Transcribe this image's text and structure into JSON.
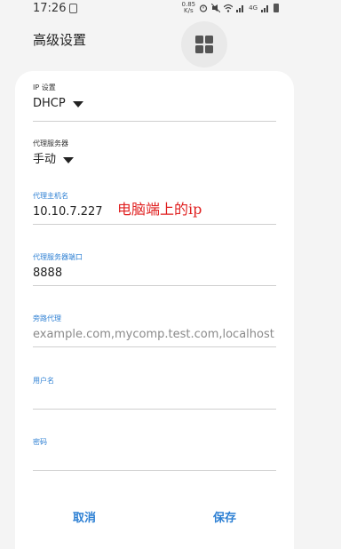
{
  "status_bar": {
    "time": "17:26",
    "speed_value": "0.85",
    "speed_unit": "K/s",
    "network": "4G"
  },
  "header": {
    "title": "高级设置"
  },
  "form": {
    "ip_settings": {
      "label": "IP 设置",
      "value": "DHCP"
    },
    "proxy": {
      "label": "代理服务器",
      "value": "手动"
    },
    "proxy_host": {
      "label": "代理主机名",
      "value": "10.10.7.227"
    },
    "proxy_port": {
      "label": "代理服务器端口",
      "value": "8888"
    },
    "bypass": {
      "label": "旁路代理",
      "placeholder": "example.com,mycomp.test.com,localhost"
    },
    "username": {
      "label": "用户名",
      "value": ""
    },
    "password": {
      "label": "密码",
      "value": ""
    }
  },
  "annotation": "电脑端上的ip",
  "actions": {
    "cancel_label": "取消",
    "save_label": "保存"
  },
  "colors": {
    "accent": "#2c7fd3",
    "annotation": "#e02020",
    "background": "#f4f4f4",
    "dialog": "#ffffff"
  }
}
